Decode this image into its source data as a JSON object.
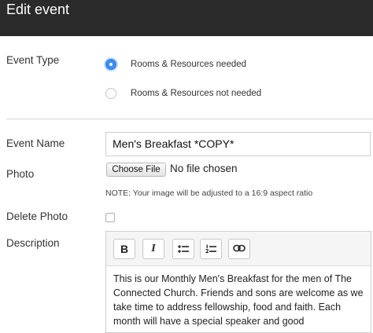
{
  "header": {
    "title": "Edit event"
  },
  "event_type": {
    "label": "Event Type",
    "options": [
      {
        "label": "Rooms & Resources needed",
        "checked": true
      },
      {
        "label": "Rooms & Resources not needed",
        "checked": false
      }
    ]
  },
  "event_name": {
    "label": "Event Name",
    "value": "Men's Breakfast *COPY*"
  },
  "photo": {
    "label": "Photo",
    "button_label": "Choose File",
    "status": "No file chosen",
    "note": "NOTE: Your image will be adjusted to a 16:9 aspect ratio"
  },
  "delete_photo": {
    "label": "Delete Photo",
    "checked": false
  },
  "description": {
    "label": "Description",
    "toolbar": [
      {
        "icon": "bold-icon",
        "glyph": "B"
      },
      {
        "icon": "italic-icon",
        "glyph": "I"
      },
      {
        "icon": "bulleted-list-icon"
      },
      {
        "icon": "numbered-list-icon"
      },
      {
        "icon": "link-icon"
      }
    ],
    "text": "This is our Monthly Men's Breakfast for the men of The Connected Church.  Friends and sons are welcome as we take time to address fellowship, food and faith.  Each month will have a special speaker and good"
  }
}
